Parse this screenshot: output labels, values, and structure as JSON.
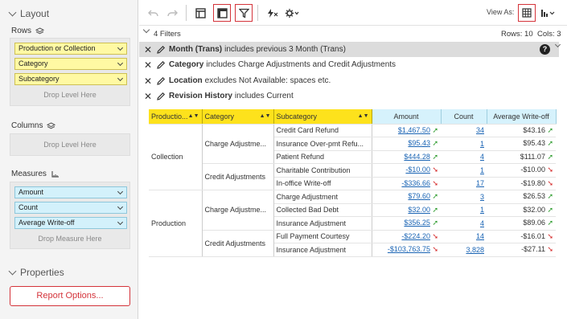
{
  "layout": {
    "title": "Layout",
    "rows_label": "Rows",
    "rows": [
      "Production or Collection",
      "Category",
      "Subcategory"
    ],
    "rows_drop": "Drop Level Here",
    "columns_label": "Columns",
    "columns_drop": "Drop Level Here",
    "measures_label": "Measures",
    "measures": [
      "Amount",
      "Count",
      "Average Write-off"
    ],
    "measures_drop": "Drop Measure Here"
  },
  "properties": {
    "title": "Properties",
    "report_button": "Report Options..."
  },
  "toolbar": {
    "view_as": "View As:"
  },
  "filters": {
    "count_label": "4 Filters",
    "rows_info": "Rows: 10",
    "cols_info": "Cols: 3",
    "items": [
      {
        "name": "Month (Trans)",
        "rest": "includes previous 3 Month (Trans)"
      },
      {
        "name": "Category",
        "rest": "includes Charge Adjustments and Credit Adjustments"
      },
      {
        "name": "Location",
        "rest": "excludes Not Available: spaces etc."
      },
      {
        "name": "Revision History",
        "rest": "includes Current"
      }
    ]
  },
  "table": {
    "headers": [
      "Productio...",
      "Category",
      "Subcategory",
      "Amount",
      "Count",
      "Average Write-off"
    ],
    "groups": {
      "collection": "Collection",
      "production": "Production"
    },
    "cats": {
      "c_charge": "Charge Adjustme...",
      "c_credit": "Credit Adjustments",
      "p_charge": "Charge Adjustme...",
      "p_credit": "Credit Adjustments"
    },
    "rows": [
      {
        "sub": "Credit Card Refund",
        "amount": "$1,467.50",
        "amt_trend": "up",
        "count": "34",
        "avg": "$43.16",
        "avg_trend": "up"
      },
      {
        "sub": "Insurance Over-pmt Refu...",
        "amount": "$95.43",
        "amt_trend": "up",
        "count": "1",
        "avg": "$95.43",
        "avg_trend": "up"
      },
      {
        "sub": "Patient Refund",
        "amount": "$444.28",
        "amt_trend": "up",
        "count": "4",
        "avg": "$111.07",
        "avg_trend": "up"
      },
      {
        "sub": "Charitable Contribution",
        "amount": "-$10.00",
        "amt_trend": "down",
        "count": "1",
        "avg": "-$10.00",
        "avg_trend": "down"
      },
      {
        "sub": "In-office Write-off",
        "amount": "-$336.66",
        "amt_trend": "down",
        "count": "17",
        "avg": "-$19.80",
        "avg_trend": "down"
      },
      {
        "sub": "Charge Adjustment",
        "amount": "$79.60",
        "amt_trend": "up",
        "count": "3",
        "avg": "$26.53",
        "avg_trend": "up"
      },
      {
        "sub": "Collected Bad Debt",
        "amount": "$32.00",
        "amt_trend": "up",
        "count": "1",
        "avg": "$32.00",
        "avg_trend": "up"
      },
      {
        "sub": "Insurance Adjustment",
        "amount": "$356.25",
        "amt_trend": "up",
        "count": "4",
        "avg": "$89.06",
        "avg_trend": "up"
      },
      {
        "sub": "Full Payment Courtesy",
        "amount": "-$224.20",
        "amt_trend": "down",
        "count": "14",
        "avg": "-$16.01",
        "avg_trend": "down"
      },
      {
        "sub": "Insurance Adjustment",
        "amount": "-$103,763.75",
        "amt_trend": "down",
        "count": "3,828",
        "avg": "-$27.11",
        "avg_trend": "down"
      }
    ]
  }
}
